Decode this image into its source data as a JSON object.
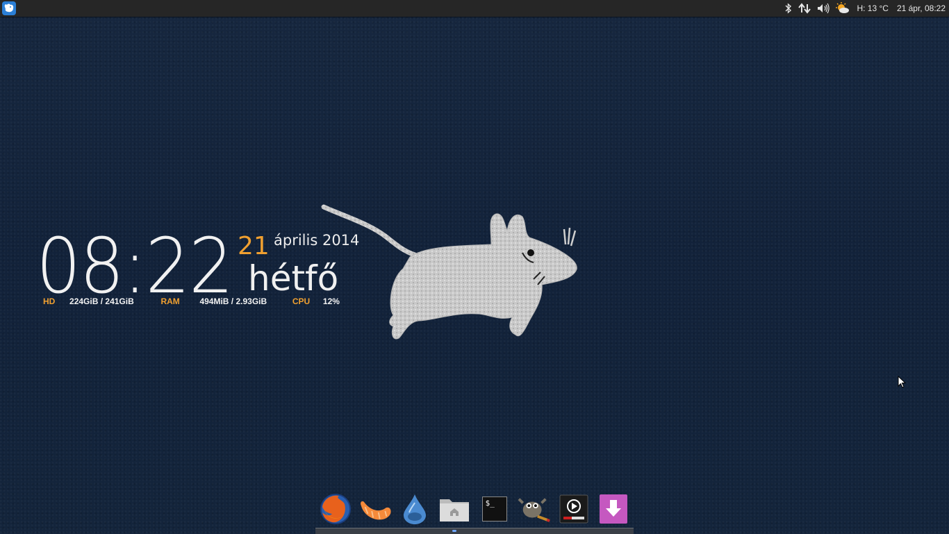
{
  "panel": {
    "menu_icon": "xfce-mouse-menu-icon",
    "tray_icons": [
      "bluetooth-icon",
      "network-icon",
      "volume-icon",
      "weather-icon"
    ],
    "weather_text": "H: 13 °C",
    "datetime_text": "21 ápr, 08:22"
  },
  "conky": {
    "time": "08:22",
    "day": "21",
    "month_year": "április 2014",
    "weekday": "hétfő",
    "hd_label": "HD",
    "hd_value": "224GiB  / 241GiB",
    "ram_label": "RAM",
    "ram_value": "494MiB  / 2.93GiB",
    "cpu_label": "CPU",
    "cpu_value": "12%"
  },
  "dock": {
    "apps": [
      "firefox-icon",
      "clementine-icon",
      "deluge-icon",
      "home-folder-icon",
      "terminal-icon",
      "gimp-icon",
      "media-player-icon",
      "download-icon"
    ],
    "terminal_glyph": "$_"
  },
  "colors": {
    "accent": "#f0a030",
    "desktop": "#13233a",
    "panel": "#262626"
  }
}
